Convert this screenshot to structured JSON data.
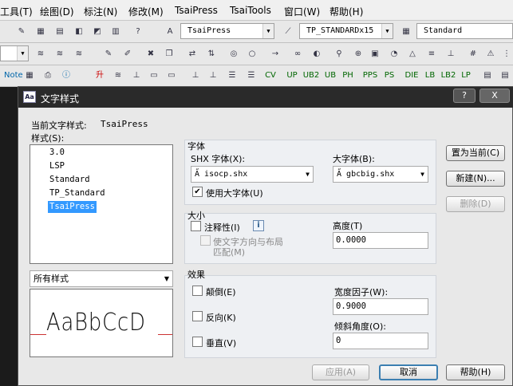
{
  "menu": [
    "工具(T)",
    "绘图(D)",
    "标注(N)",
    "修改(M)",
    "TsaiPress",
    "TsaiTools",
    "窗口(W)",
    "帮助(H)"
  ],
  "toolbar1": {
    "text_style_combo": "TsaiPress",
    "dim_style_combo": "TP_STANDARDx15",
    "table_style_combo": "Standard"
  },
  "toolbar3_labels": [
    "Note",
    "升",
    "CV",
    "UP",
    "UB2",
    "UB",
    "PH",
    "PPS",
    "PS",
    "DIE",
    "LB",
    "LB2",
    "LP"
  ],
  "dialog": {
    "title": "文字样式",
    "help_button": "?",
    "close_button": "X",
    "current_style_label": "当前文字样式:",
    "current_style_value": "TsaiPress",
    "styles_label": "样式(S):",
    "styles": [
      "3.0",
      "LSP",
      "Standard",
      "TP_Standard",
      "TsaiPress"
    ],
    "selected_style": "TsaiPress",
    "filter_value": "所有样式",
    "preview_text": "AaBbCcD",
    "font_group": {
      "title": "字体",
      "shx_label": "SHX 字体(X):",
      "shx_value": "isocp.shx",
      "big_font_label": "大字体(B):",
      "big_font_value": "gbcbig.shx",
      "use_big_font_label": "使用大字体(U)",
      "use_big_font_checked": true
    },
    "size_group": {
      "title": "大小",
      "annotative_label": "注释性(I)",
      "annotative_checked": false,
      "match_orientation_label_1": "使文字方向与布局",
      "match_orientation_label_2": "匹配(M)",
      "height_label": "高度(T)",
      "height_value": "0.0000"
    },
    "effects_group": {
      "title": "效果",
      "upside_down_label": "颠倒(E)",
      "backwards_label": "反向(K)",
      "vertical_label": "垂直(V)",
      "width_factor_label": "宽度因子(W):",
      "width_factor_value": "0.9000",
      "oblique_label": "倾斜角度(O):",
      "oblique_value": "0"
    },
    "buttons": {
      "set_current": "置为当前(C)",
      "new": "新建(N)...",
      "delete": "删除(D)",
      "apply": "应用(A)",
      "cancel": "取消",
      "help": "帮助(H)"
    }
  }
}
